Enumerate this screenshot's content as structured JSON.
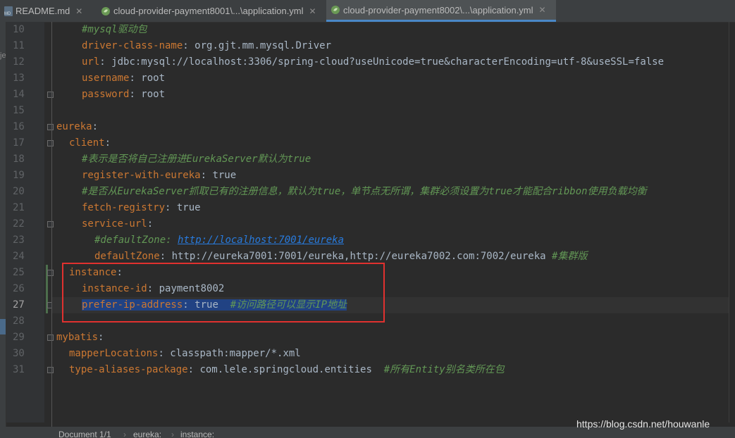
{
  "tabs": [
    {
      "label": "README.md",
      "icon": "markdown-file-icon",
      "active": false
    },
    {
      "label": "cloud-provider-payment8001\\...\\application.yml",
      "icon": "spring-yml-icon",
      "active": false
    },
    {
      "label": "cloud-provider-payment8002\\...\\application.yml",
      "icon": "spring-yml-icon",
      "active": true
    }
  ],
  "left_strip_text": "je",
  "line_numbers": [
    "10",
    "11",
    "12",
    "13",
    "14",
    "15",
    "16",
    "17",
    "18",
    "19",
    "20",
    "21",
    "22",
    "23",
    "24",
    "25",
    "26",
    "27",
    "28",
    "29",
    "30",
    "31"
  ],
  "current_line": "27",
  "code": {
    "l10": {
      "comment": "#mysql驱动包"
    },
    "l11": {
      "key": "driver-class-name",
      "value": " org.gjt.mm.mysql.Driver"
    },
    "l12": {
      "key": "url",
      "value": " jdbc:mysql://localhost:3306/spring-cloud?useUnicode=true&characterEncoding=utf-8&useSSL=false"
    },
    "l13": {
      "key": "username",
      "value": " root"
    },
    "l14": {
      "key": "password",
      "value": " root"
    },
    "l16": {
      "key": "eureka"
    },
    "l17": {
      "key": "client"
    },
    "l18": {
      "comment": "#表示是否将自己注册进EurekaServer默认为true"
    },
    "l19": {
      "key": "register-with-eureka",
      "value": " true"
    },
    "l20": {
      "comment": "#是否从EurekaServer抓取已有的注册信息，默认为true，单节点无所谓，集群必须设置为true才能配合ribbon使用负载均衡"
    },
    "l21": {
      "key": "fetch-registry",
      "value": " true"
    },
    "l22": {
      "key": "service-url"
    },
    "l23": {
      "comment_prefix": "#defaultZone: ",
      "url": "http://localhost:7001/eureka"
    },
    "l24": {
      "key": "defaultZone",
      "value": " http://eureka7001:7001/eureka,http://eureka7002.com:7002/eureka ",
      "comment": "#集群版"
    },
    "l25": {
      "key": "instance"
    },
    "l26": {
      "key": "instance-id",
      "value": " payment8002"
    },
    "l27": {
      "key": "prefer-ip-address",
      "value": " true  ",
      "comment": "#访问路径可以显示IP地址"
    },
    "l29": {
      "key": "mybatis"
    },
    "l30": {
      "key": "mapperLocations",
      "value": " classpath:mapper/*.xml"
    },
    "l31": {
      "key": "type-aliases-package",
      "value": " com.lele.springcloud.entities  ",
      "comment": "#所有Entity别名类所在包"
    }
  },
  "statusbar": {
    "document": "Document 1/1",
    "crumb1": "eureka:",
    "crumb2": "instance:"
  },
  "watermark": "https://blog.csdn.net/houwanle",
  "colors": {
    "key": "#cc7832",
    "comment": "#629755",
    "text": "#a9b7c6",
    "selection": "#214283",
    "highlight_box": "#e0312f"
  }
}
